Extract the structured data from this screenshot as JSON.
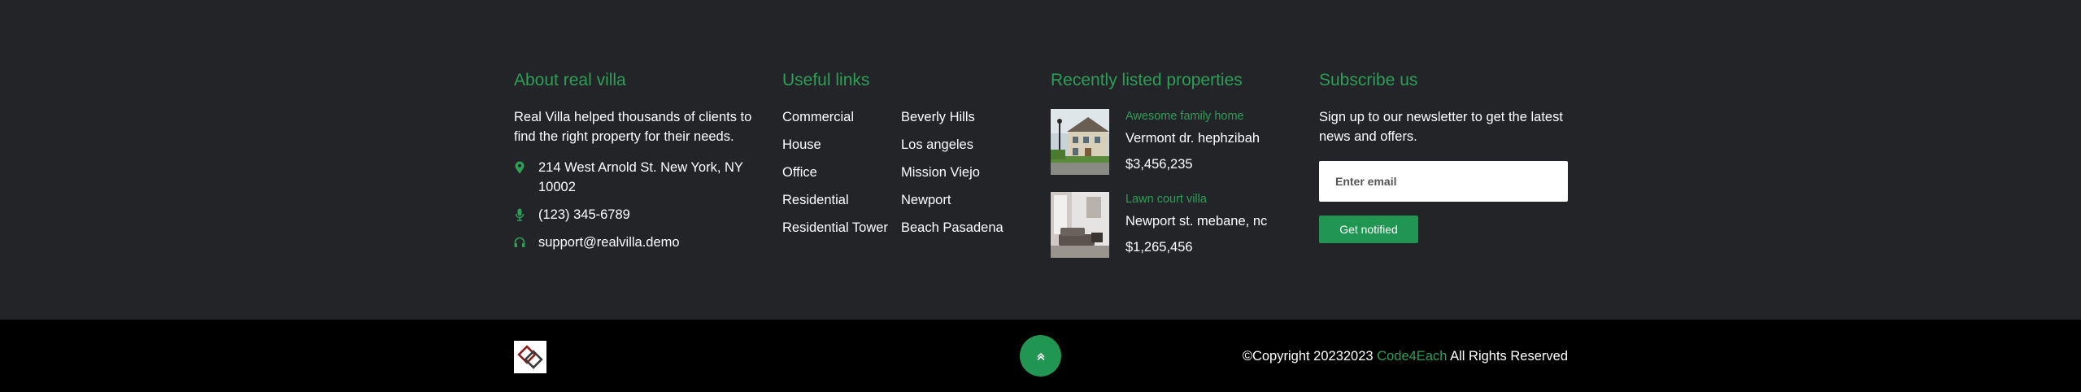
{
  "about": {
    "title": "About real villa",
    "text": "Real Villa helped thousands of clients to find the right property for their needs.",
    "contacts": [
      {
        "icon": "map-marker-icon",
        "text": "214 West Arnold St. New York, NY 10002"
      },
      {
        "icon": "microphone-icon",
        "text": "(123) 345-6789"
      },
      {
        "icon": "headphones-icon",
        "text": "support@realvilla.demo"
      }
    ]
  },
  "useful_links": {
    "title": "Useful links",
    "col1": [
      "Commercial",
      "House",
      "Office",
      "Residential",
      "Residential Tower"
    ],
    "col2": [
      "Beverly Hills",
      "Los angeles",
      "Mission Viejo",
      "Newport",
      "Beach Pasadena"
    ]
  },
  "recent": {
    "title": "Recently listed properties",
    "items": [
      {
        "name": "Awesome family home",
        "address": "Vermont dr. hephzibah",
        "price": "$3,456,235"
      },
      {
        "name": "Lawn court villa",
        "address": "Newport st. mebane, nc",
        "price": "$1,265,456"
      }
    ]
  },
  "subscribe": {
    "title": "Subscribe us",
    "text": "Sign up to our newsletter to get the latest news and offers.",
    "email_placeholder": "Enter email",
    "button_label": "Get notified"
  },
  "bottom": {
    "logo_icon": "real-villa-logo-icon",
    "back_to_top_icon": "chevron-double-up-icon",
    "copyright_prefix": "©Copyright 20232023",
    "copyright_brand": "Code4Each",
    "copyright_suffix": "All Rights Reserved"
  },
  "colors": {
    "accent": "#2e9e57",
    "button": "#219653",
    "top_bg": "#222428",
    "bottom_bg": "#000000"
  }
}
